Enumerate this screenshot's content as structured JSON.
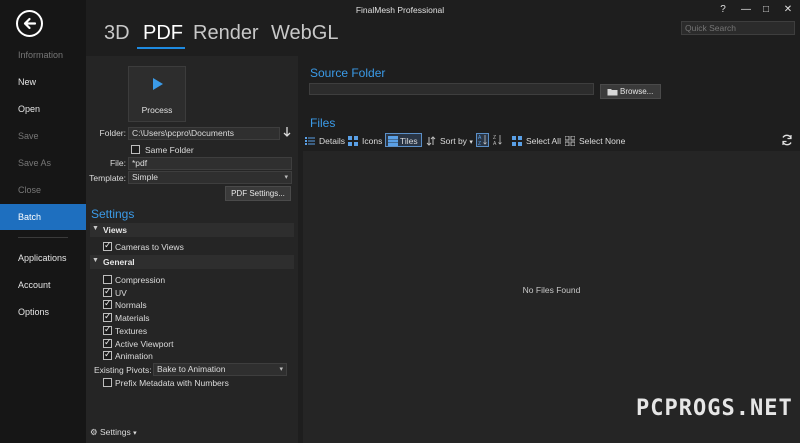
{
  "app": {
    "title": "FinalMesh Professional"
  },
  "window": {
    "help": "?",
    "minimize": "—",
    "maximize": "□",
    "close": "✕"
  },
  "search": {
    "placeholder": "Quick Search"
  },
  "nav": {
    "items": [
      {
        "label": "Information",
        "state": "disabled"
      },
      {
        "label": "New",
        "state": "normal"
      },
      {
        "label": "Open",
        "state": "normal"
      },
      {
        "label": "Save",
        "state": "disabled"
      },
      {
        "label": "Save As",
        "state": "disabled"
      },
      {
        "label": "Close",
        "state": "disabled"
      },
      {
        "label": "Batch",
        "state": "active"
      },
      {
        "label": "Applications",
        "state": "normal"
      },
      {
        "label": "Account",
        "state": "normal"
      },
      {
        "label": "Options",
        "state": "normal"
      }
    ]
  },
  "tabs": [
    {
      "label": "3D",
      "active": false
    },
    {
      "label": "PDF",
      "active": true
    },
    {
      "label": "Render",
      "active": false
    },
    {
      "label": "WebGL",
      "active": false
    }
  ],
  "process": {
    "label": "Process"
  },
  "form": {
    "folder_label": "Folder:",
    "folder_value": "C:\\Users\\pcpro\\Documents",
    "same_folder_label": "Same Folder",
    "same_folder_checked": false,
    "file_label": "File:",
    "file_value": "*pdf",
    "template_label": "Template:",
    "template_value": "Simple",
    "pdf_settings_button": "PDF Settings..."
  },
  "settings": {
    "heading": "Settings",
    "views_header": "Views",
    "views": [
      {
        "label": "Cameras to Views",
        "checked": true
      }
    ],
    "general_header": "General",
    "general": [
      {
        "label": "Compression",
        "checked": false
      },
      {
        "label": "UV",
        "checked": true
      },
      {
        "label": "Normals",
        "checked": true
      },
      {
        "label": "Materials",
        "checked": true
      },
      {
        "label": "Textures",
        "checked": true
      },
      {
        "label": "Active Viewport",
        "checked": true
      },
      {
        "label": "Animation",
        "checked": true
      }
    ],
    "pivots_label": "Existing Pivots:",
    "pivots_value": "Bake to Animation",
    "prefix_label": "Prefix Metadata with Numbers",
    "prefix_checked": false,
    "footer_label": "Settings"
  },
  "source": {
    "heading": "Source Folder",
    "browse_button": "Browse..."
  },
  "files": {
    "heading": "Files",
    "toolbar": {
      "details": "Details",
      "icons": "Icons",
      "tiles": "Tiles",
      "sort_by": "Sort by",
      "select_all": "Select All",
      "select_none": "Select None"
    },
    "empty_text": "No Files Found"
  },
  "watermark": {
    "text": "PCPROGS.NET"
  },
  "colors": {
    "accent": "#1e6fbf",
    "heading": "#3b9be8",
    "background": "#1e1e1e"
  }
}
